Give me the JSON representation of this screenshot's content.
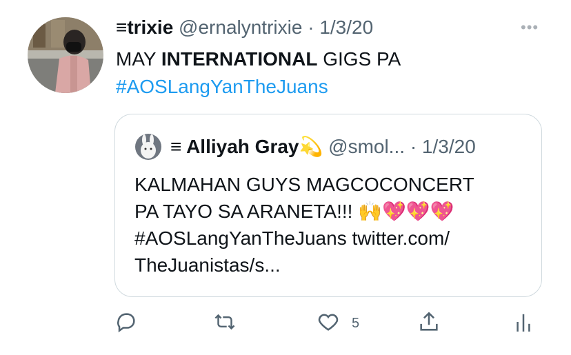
{
  "tweet": {
    "display_name": "≡trixie",
    "handle": "@ernalyntrixie",
    "separator": "·",
    "date": "1/3/20",
    "text_prefix": "MAY ",
    "text_bold": "INTERNATIONAL",
    "text_suffix": " GIGS PA",
    "hashtag": "#AOSLangYanTheJuans",
    "more_label": "•••"
  },
  "quote": {
    "display_name": "≡ Alliyah Gray",
    "name_emoji": "💫",
    "handle": "@smol...",
    "separator": "·",
    "date": "1/3/20",
    "line1": "KALMAHAN GUYS MAGCOCONCERT",
    "line2_text": "PA TAYO SA ARANETA!!! ",
    "line2_emojis": "🙌💖💖💖",
    "line3_hashtag": "#AOSLangYanTheJuans",
    "line3_link": " twitter.com/",
    "line4": "TheJuanistas/s..."
  },
  "actions": {
    "reply_icon": "reply-icon",
    "retweet_icon": "retweet-icon",
    "like_icon": "heart-icon",
    "like_count": "5",
    "share_icon": "share-icon",
    "analytics_icon": "analytics-icon"
  },
  "colors": {
    "link": "#1d9bf0",
    "muted": "#536471",
    "border": "#cfd9de"
  }
}
